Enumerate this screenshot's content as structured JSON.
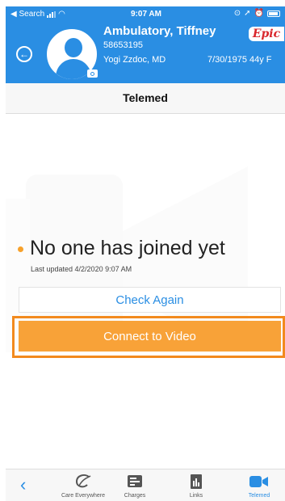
{
  "status_bar": {
    "back_app": "◀ Search",
    "time": "9:07 AM"
  },
  "header": {
    "patient_name": "Ambulatory, Tiffney",
    "mrn": "58653195",
    "provider": "Yogi Zzdoc, MD",
    "dob_age": "7/30/1975 44y F",
    "logo_text": "Epic",
    "brand_color": "#2a8ee3"
  },
  "page": {
    "title": "Telemed"
  },
  "telemed": {
    "status_text": "No one has joined yet",
    "last_updated": "Last updated 4/2/2020 9:07 AM",
    "check_again_label": "Check Again",
    "connect_label": "Connect to Video",
    "accent_color": "#f8a238"
  },
  "tabbar": {
    "back_icon": "chevron-left-icon",
    "tabs": [
      {
        "label": "Care Everywhere",
        "icon": "care-everywhere-icon"
      },
      {
        "label": "Charges",
        "icon": "charges-icon"
      },
      {
        "label": "Links",
        "icon": "links-icon"
      },
      {
        "label": "Telemed",
        "icon": "video-camera-icon",
        "active": true
      }
    ]
  }
}
